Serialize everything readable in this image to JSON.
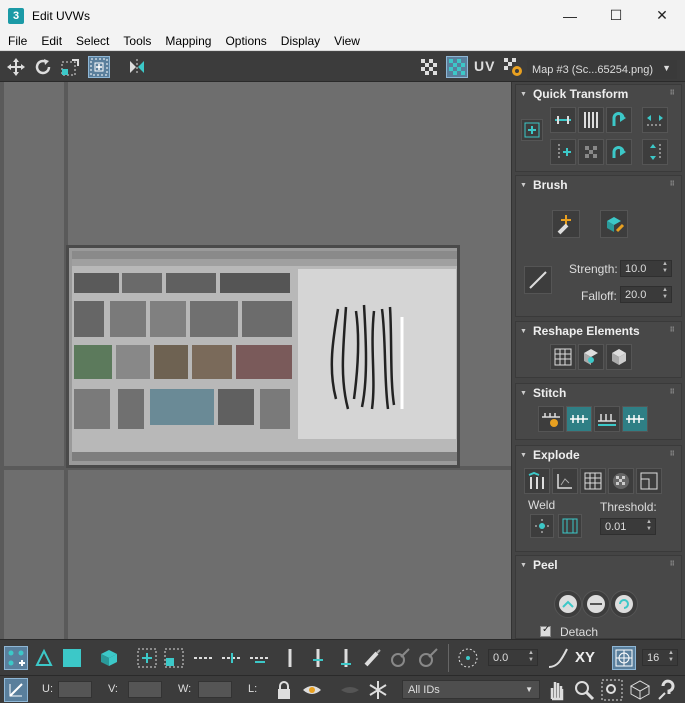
{
  "window": {
    "title": "Edit UVWs",
    "app_icon_text": "3",
    "minimize": "—",
    "maximize": "☐",
    "close": "✕"
  },
  "menu": [
    "File",
    "Edit",
    "Select",
    "Tools",
    "Mapping",
    "Options",
    "Display",
    "View"
  ],
  "toolbar": {
    "uv_label": "UV",
    "map_select": "Map #3 (Sc...65254.png)"
  },
  "panel": {
    "quick_transform": "Quick Transform",
    "brush": "Brush",
    "strength_label": "Strength:",
    "strength_value": "10.0",
    "falloff_label": "Falloff:",
    "falloff_value": "20.0",
    "reshape": "Reshape Elements",
    "stitch": "Stitch",
    "explode": "Explode",
    "weld_label": "Weld",
    "threshold_label": "Threshold:",
    "threshold_value": "0.01",
    "peel": "Peel",
    "detach_label": "Detach"
  },
  "bottom": {
    "angle_value": "0.0",
    "xy_label": "XY",
    "snap_value": "16",
    "u_label": "U:",
    "v_label": "V:",
    "w_label": "W:",
    "l_label": "L:",
    "ids_select": "All IDs"
  },
  "colors": {
    "accent": "#3cc8c8",
    "panel_bg": "#444444",
    "viewport_bg": "#6e6e6e"
  }
}
